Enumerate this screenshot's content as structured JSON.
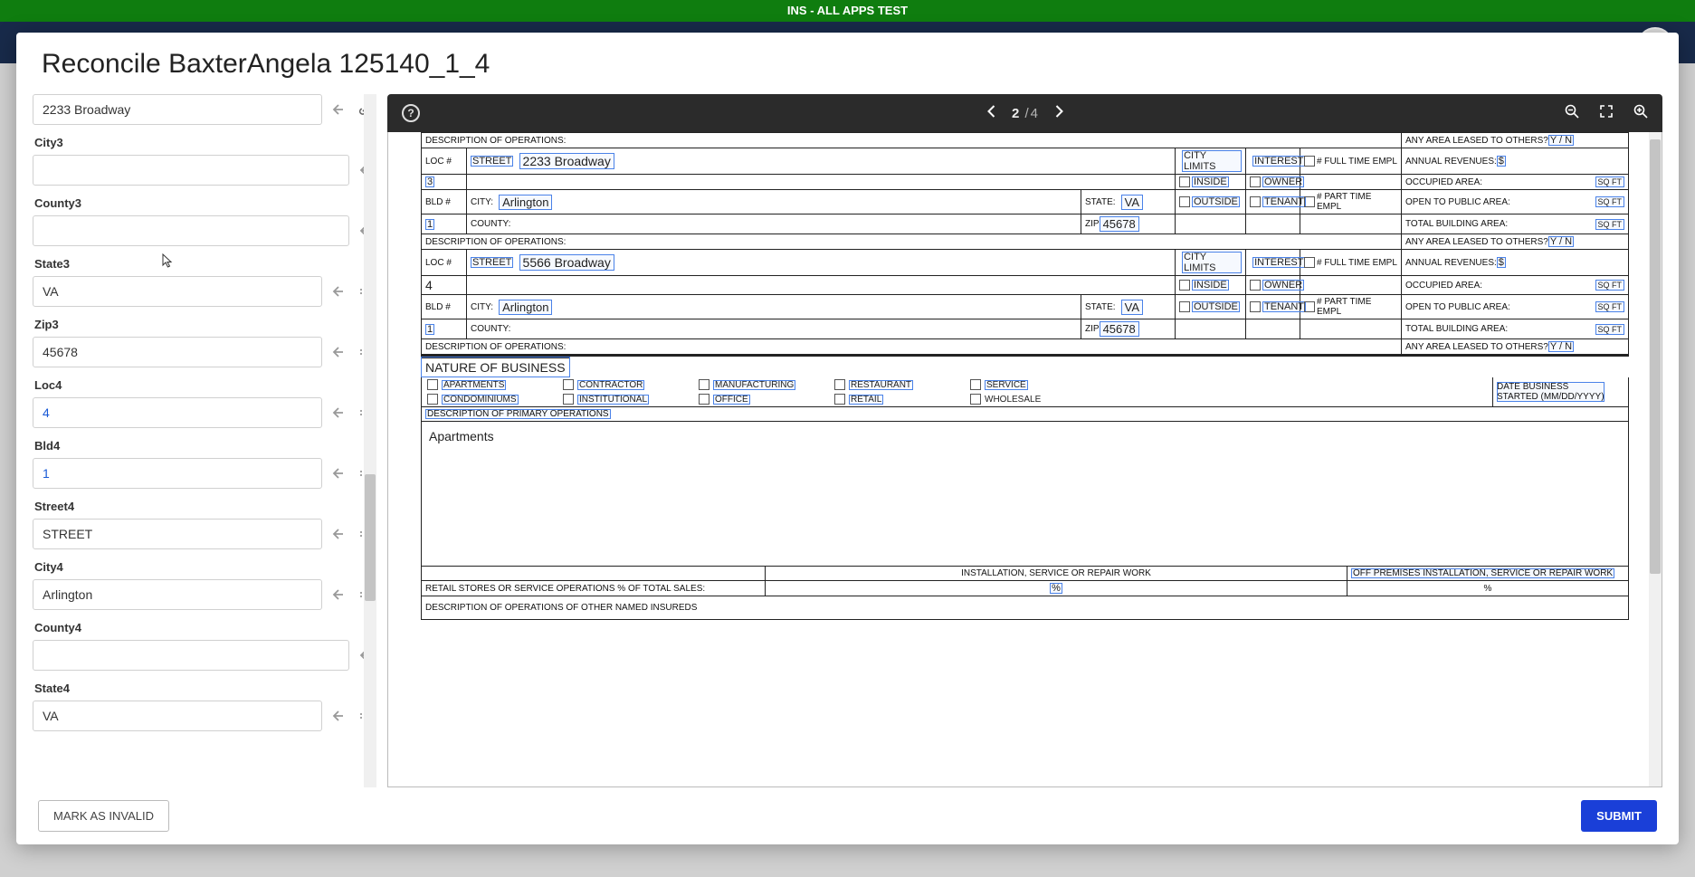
{
  "banner": {
    "title": "INS - ALL APPS TEST"
  },
  "modal": {
    "title": "Reconcile BaxterAngela 125140_1_4",
    "footer": {
      "invalid": "MARK AS INVALID",
      "submit": "SUBMIT"
    }
  },
  "viewer": {
    "page_current": "2",
    "page_sep": "/",
    "page_total": "4"
  },
  "left_fields": [
    {
      "label": "",
      "value": "2233 Broadway",
      "icons": [
        "back",
        "link"
      ],
      "blue": false,
      "labelHidden": true
    },
    {
      "label": "City3",
      "value": "",
      "icons": [
        "back"
      ]
    },
    {
      "label": "County3",
      "value": "",
      "icons": [
        "back"
      ]
    },
    {
      "label": "State3",
      "value": "VA",
      "icons": [
        "back",
        "dots"
      ]
    },
    {
      "label": "Zip3",
      "value": "45678",
      "icons": [
        "back",
        "dots"
      ]
    },
    {
      "label": "Loc4",
      "value": "4",
      "icons": [
        "back",
        "dots"
      ],
      "blue": true
    },
    {
      "label": "Bld4",
      "value": "1",
      "icons": [
        "back",
        "dots"
      ],
      "blue": true
    },
    {
      "label": "Street4",
      "value": "STREET",
      "icons": [
        "back",
        "dots"
      ]
    },
    {
      "label": "City4",
      "value": "Arlington",
      "icons": [
        "back",
        "dots"
      ]
    },
    {
      "label": "County4",
      "value": "",
      "icons": [
        "back"
      ]
    },
    {
      "label": "State4",
      "value": "VA",
      "icons": [
        "back",
        "dots"
      ]
    }
  ],
  "doc": {
    "desc_ops": "DESCRIPTION OF OPERATIONS:",
    "leased_q": "ANY AREA LEASED TO OTHERS?",
    "yn": "Y / N",
    "loc_lab": "LOC #",
    "street_lab": "STREET",
    "city_limits": "CITY LIMITS",
    "interest": "INTEREST",
    "ft_empl": "# FULL TIME EMPL",
    "pt_empl": "# PART TIME EMPL",
    "annual_rev": "ANNUAL REVENUES: $",
    "occupied": "OCCUPIED AREA:",
    "open_public": "OPEN TO PUBLIC AREA:",
    "total_bldg": "TOTAL BUILDING AREA:",
    "sqft": "SQ FT",
    "bld_lab": "BLD #",
    "city_lab": "CITY:",
    "state_lab": "STATE:",
    "county_lab": "COUNTY:",
    "zip_lab": "ZIP",
    "inside": "INSIDE",
    "outside": "OUTSIDE",
    "owner": "OWNER",
    "tenant": "TENANT",
    "loc3": {
      "loc": "3",
      "street": "2233 Broadway",
      "bld": "1",
      "city": "Arlington",
      "state": "VA",
      "zip": "45678"
    },
    "loc4": {
      "loc": "4",
      "street": "5566 Broadway",
      "bld": "1",
      "city": "Arlington",
      "state": "VA",
      "zip": "45678"
    },
    "nature_hdr": "NATURE OF BUSINESS",
    "nature_opts_row1": [
      "APARTMENTS",
      "CONTRACTOR",
      "MANUFACTURING",
      "RESTAURANT",
      "SERVICE"
    ],
    "nature_opts_row2": [
      "CONDOMINIUMS",
      "INSTITUTIONAL",
      "OFFICE",
      "RETAIL",
      "WHOLESALE"
    ],
    "date_biz": "DATE BUSINESS STARTED (MM/DD/YYYY)",
    "desc_primary_hdr": "DESCRIPTION OF PRIMARY OPERATIONS",
    "desc_primary_val": "Apartments",
    "retail_pct": "RETAIL STORES OR SERVICE OPERATIONS % OF TOTAL SALES:",
    "install_work": "INSTALLATION, SERVICE OR REPAIR WORK",
    "offprem_install": "OFF PREMISES INSTALLATION, SERVICE OR REPAIR WORK",
    "pct": "%",
    "desc_other_named": "DESCRIPTION OF OPERATIONS OF OTHER NAMED INSUREDS"
  }
}
